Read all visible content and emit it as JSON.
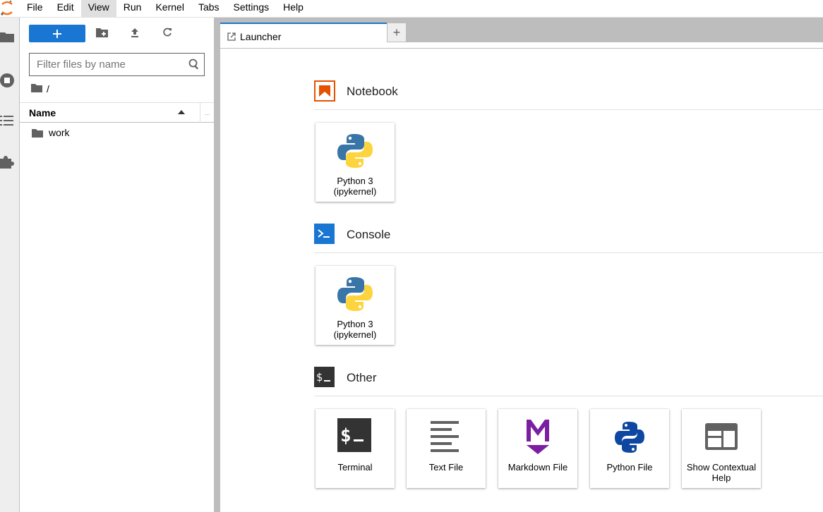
{
  "menubar": {
    "items": [
      "File",
      "Edit",
      "View",
      "Run",
      "Kernel",
      "Tabs",
      "Settings",
      "Help"
    ],
    "active": "View"
  },
  "filebrowser": {
    "filter_placeholder": "Filter files by name",
    "breadcrumb": "/",
    "column_name": "Name",
    "column_more": "...",
    "files": [
      {
        "name": "work",
        "type": "folder"
      }
    ]
  },
  "tabs": {
    "launcher_label": "Launcher",
    "add_label": "+"
  },
  "launcher": {
    "sections": [
      {
        "title": "Notebook",
        "icon": "notebook-icon",
        "cards": [
          {
            "label": "Python 3 (ipykernel)",
            "icon": "python-logo-icon"
          }
        ]
      },
      {
        "title": "Console",
        "icon": "console-icon",
        "cards": [
          {
            "label": "Python 3 (ipykernel)",
            "icon": "python-logo-icon"
          }
        ]
      },
      {
        "title": "Other",
        "icon": "terminal-icon",
        "cards": [
          {
            "label": "Terminal",
            "icon": "terminal-icon"
          },
          {
            "label": "Text File",
            "icon": "text-file-icon"
          },
          {
            "label": "Markdown File",
            "icon": "markdown-icon"
          },
          {
            "label": "Python File",
            "icon": "python-file-icon"
          },
          {
            "label": "Show Contextual Help",
            "icon": "contextual-help-icon"
          }
        ]
      }
    ]
  },
  "colors": {
    "accent": "#1976d2",
    "notebook_orange": "#e65100",
    "markdown_purple": "#7b1fa2",
    "python_blue": "#0d47a1"
  }
}
